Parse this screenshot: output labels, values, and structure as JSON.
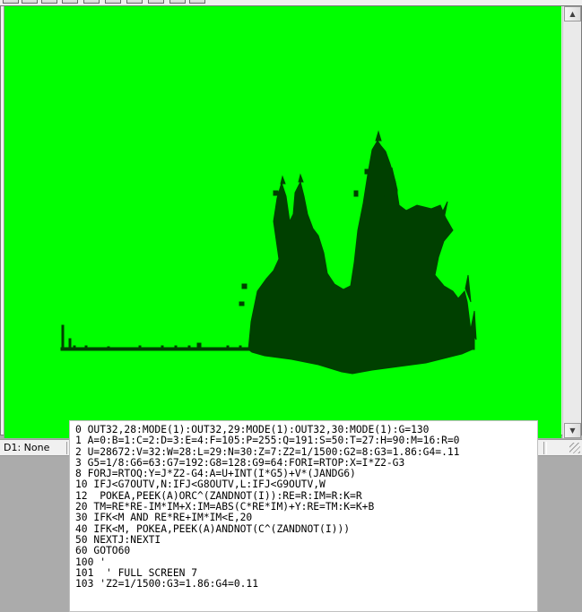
{
  "status_bar": {
    "drive_status": "D1: None"
  },
  "colors": {
    "canvas_background": "#00ff00",
    "fractal_shape": "#004000"
  },
  "fractal": {
    "description_icon": "fractal-shape-icon"
  },
  "code_lines": [
    "0 OUT32,28:MODE(1):OUT32,29:MODE(1):OUT32,30:MODE(1):G=130",
    "1 A=0:B=1:C=2:D=3:E=4:F=105:P=255:Q=191:S=50:T=27:H=90:M=16:R=0",
    "2 U=28672:V=32:W=28:L=29:N=30:Z=7:Z2=1/1500:G2=8:G3=1.86:G4=.11",
    "3 G5=1/8:G6=63:G7=192:G8=128:G9=64:FORI=RTOP:X=I*Z2-G3",
    "8 FORJ=RTOQ:Y=J*Z2-G4:A=U+INT(I*G5)+V*(JANDG6)",
    "10 IFJ<G7OUTV,N:IFJ<G8OUTV,L:IFJ<G9OUTV,W",
    "12  POKEA,PEEK(A)ORC^(ZANDNOT(I)):RE=R:IM=R:K=R",
    "20 TM=RE*RE-IM*IM+X:IM=ABS(C*RE*IM)+Y:RE=TM:K=K+B",
    "30 IFK<M AND RE*RE+IM*IM<E,20",
    "40 IFK<M, POKEA,PEEK(A)ANDNOT(C^(ZANDNOT(I)))",
    "50 NEXTJ:NEXTI",
    "60 GOTO60",
    "100 '",
    "101  ' FULL SCREEN 7",
    "103 'Z2=1/1500:G3=1.86:G4=0.11"
  ]
}
